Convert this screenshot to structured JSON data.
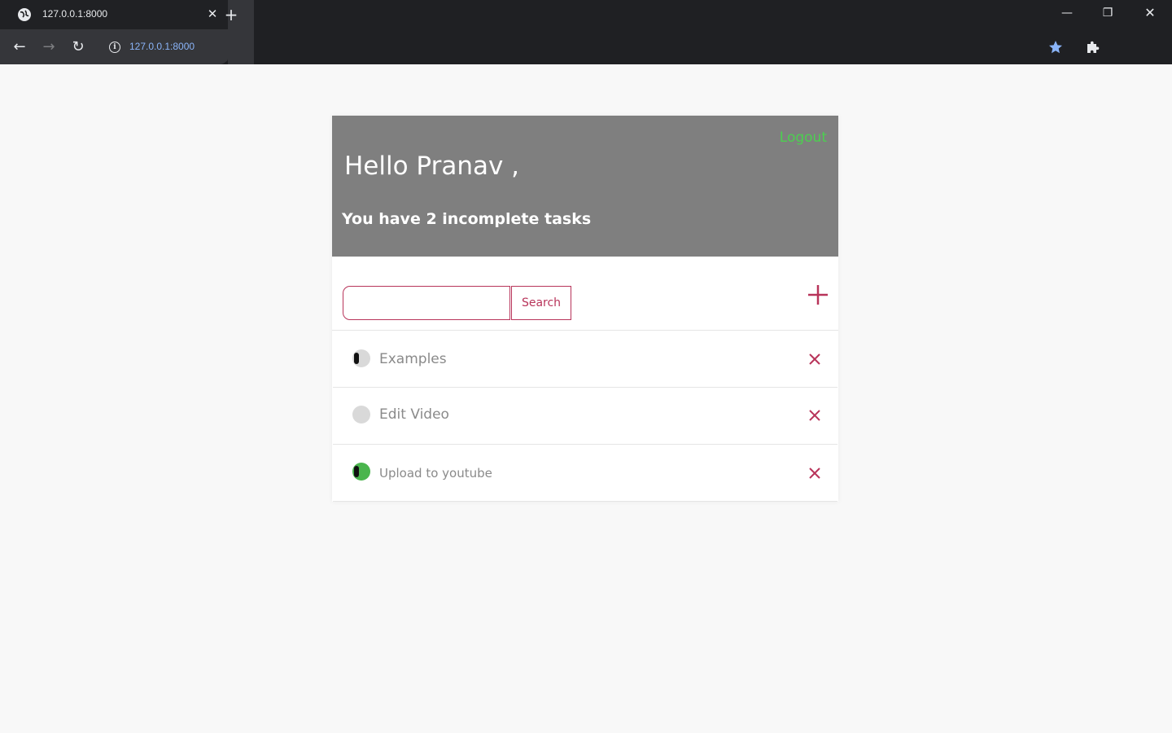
{
  "browser": {
    "tab_title": "127.0.0.1:8000",
    "url": "127.0.0.1:8000",
    "tab_close": "✕",
    "new_tab": "+",
    "back": "←",
    "forward": "→",
    "reload": "↻",
    "info": "i",
    "minimize": "—",
    "restore": "❐",
    "close": "✕",
    "bookmark_color": "#8ab4f8"
  },
  "header": {
    "logout_label": "Logout",
    "greeting": "Hello Pranav ,",
    "incomplete_text": "You have 2 incomplete tasks",
    "background": "#7f7f7f",
    "logout_color": "#4ccf50"
  },
  "search": {
    "value": "",
    "placeholder": "",
    "button_label": "Search"
  },
  "tasks": [
    {
      "title": "Examples",
      "complete": false,
      "toggle_icon": "toggle-off-icon"
    },
    {
      "title": "Edit Video",
      "complete": false,
      "toggle_icon": "circle-icon"
    },
    {
      "title": "Upload to youtube",
      "complete": true,
      "toggle_icon": "toggle-on-icon"
    }
  ],
  "colors": {
    "accent": "#b8345a",
    "complete": "#4ab54d"
  }
}
